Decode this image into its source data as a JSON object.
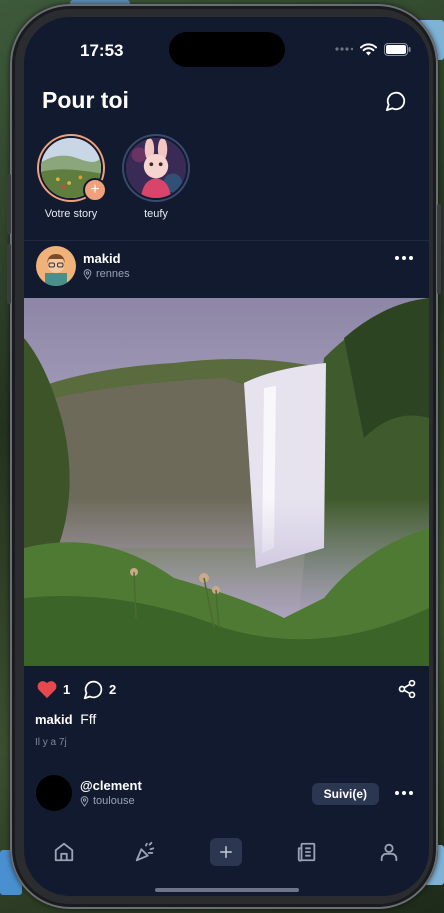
{
  "status_bar": {
    "time": "17:53"
  },
  "header": {
    "title": "Pour toi",
    "messages_icon": "message-circle-icon"
  },
  "stories": [
    {
      "label": "Votre story",
      "is_own": true,
      "add_icon": "plus-icon",
      "ring_color": "#f0a07a"
    },
    {
      "label": "teufy",
      "is_own": false,
      "ring_color": "#3b4a6b"
    }
  ],
  "post": {
    "username": "makid",
    "location": "rennes",
    "likes": "1",
    "comments": "2",
    "caption_user": "makid",
    "caption_text": "Fff",
    "time_ago": "Il y a 7j",
    "liked": true,
    "like_color": "#e5484d"
  },
  "next_post": {
    "username": "@clement",
    "location": "toulouse",
    "follow_label": "Suivi(e)"
  },
  "tab_bar": {
    "items": [
      {
        "name": "home",
        "icon": "home-icon"
      },
      {
        "name": "party",
        "icon": "party-popper-icon"
      },
      {
        "name": "create",
        "icon": "plus-icon"
      },
      {
        "name": "news",
        "icon": "newspaper-icon"
      },
      {
        "name": "profile",
        "icon": "user-icon"
      }
    ]
  },
  "colors": {
    "background": "#111a2e",
    "accent": "#f0a07a",
    "button": "#2b3650"
  }
}
